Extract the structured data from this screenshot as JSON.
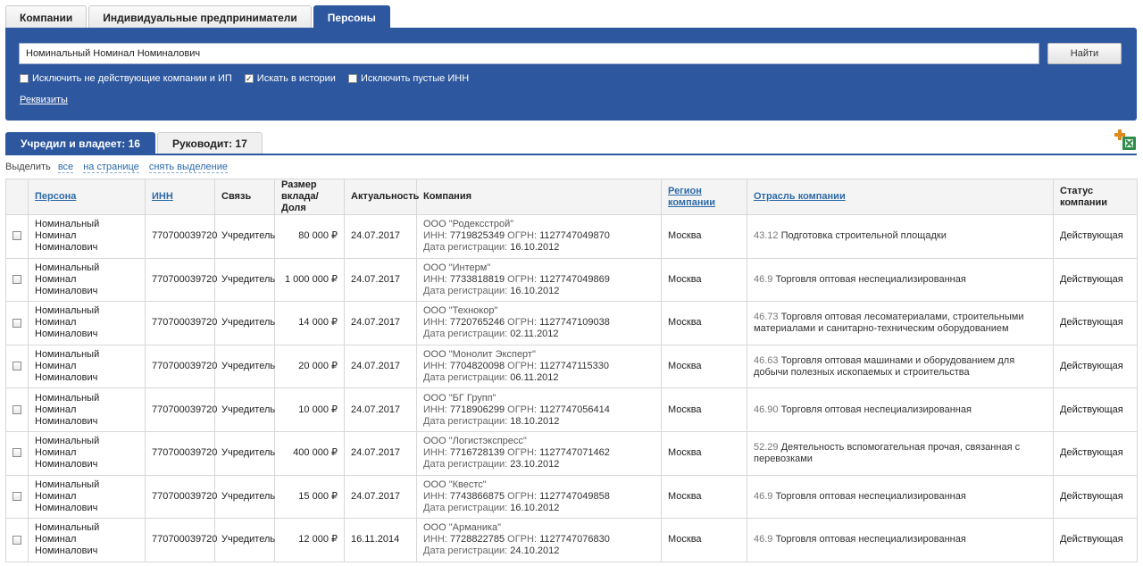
{
  "top_tabs": [
    "Компании",
    "Индивидуальные предприниматели",
    "Персоны"
  ],
  "top_tab_active": 2,
  "search": {
    "value": "Номинальный Номинал Номиналович",
    "button": "Найти",
    "options": [
      {
        "label": "Исключить не действующие компании и ИП",
        "checked": false
      },
      {
        "label": "Искать в истории",
        "checked": true
      },
      {
        "label": "Исключить пустые ИНН",
        "checked": false
      }
    ],
    "requisites_link": "Реквизиты"
  },
  "result_tabs": [
    "Учредил и владеет: 16",
    "Руководит: 17"
  ],
  "result_tab_active": 0,
  "excel_icon": "excel-export-icon",
  "select": {
    "label": "Выделить",
    "all": "все",
    "page": "на странице",
    "clear": "снять выделение"
  },
  "table": {
    "headers": {
      "person": "Персона",
      "inn": "ИНН",
      "link": "Связь",
      "share": "Размер вклада/Доля",
      "actuality": "Актуальность",
      "company": "Компания",
      "region": "Регион компании",
      "industry": "Отрасль компании",
      "status": "Статус компании"
    },
    "labels": {
      "inn": "ИНН:",
      "ogrn": "ОГРН:",
      "reg": "Дата регистрации:"
    },
    "rows": [
      {
        "person": "Номинальный Номинал Номиналович",
        "inn": "770700039720",
        "link": "Учредитель",
        "share": "80 000 ₽",
        "date": "24.07.2017",
        "company": "ООО \"Родексстрой\"",
        "company_inn": "7719825349",
        "company_ogrn": "1127747049870",
        "reg_date": "16.10.2012",
        "region": "Москва",
        "okved_code": "43.12",
        "okved_text": "Подготовка строительной площадки",
        "status": "Действующая"
      },
      {
        "person": "Номинальный Номинал Номиналович",
        "inn": "770700039720",
        "link": "Учредитель",
        "share": "1 000 000 ₽",
        "date": "24.07.2017",
        "company": "ООО \"Интерм\"",
        "company_inn": "7733818819",
        "company_ogrn": "1127747049869",
        "reg_date": "16.10.2012",
        "region": "Москва",
        "okved_code": "46.9",
        "okved_text": "Торговля оптовая неспециализированная",
        "status": "Действующая"
      },
      {
        "person": "Номинальный Номинал Номиналович",
        "inn": "770700039720",
        "link": "Учредитель",
        "share": "14 000 ₽",
        "date": "24.07.2017",
        "company": "ООО \"Технокор\"",
        "company_inn": "7720765246",
        "company_ogrn": "1127747109038",
        "reg_date": "02.11.2012",
        "region": "Москва",
        "okved_code": "46.73",
        "okved_text": "Торговля оптовая лесоматериалами, строительными материалами и санитарно-техническим оборудованием",
        "status": "Действующая"
      },
      {
        "person": "Номинальный Номинал Номиналович",
        "inn": "770700039720",
        "link": "Учредитель",
        "share": "20 000 ₽",
        "date": "24.07.2017",
        "company": "ООО \"Монолит Эксперт\"",
        "company_inn": "7704820098",
        "company_ogrn": "1127747115330",
        "reg_date": "06.11.2012",
        "region": "Москва",
        "okved_code": "46.63",
        "okved_text": "Торговля оптовая машинами и оборудованием для добычи полезных ископаемых и строительства",
        "status": "Действующая"
      },
      {
        "person": "Номинальный Номинал Номиналович",
        "inn": "770700039720",
        "link": "Учредитель",
        "share": "10 000 ₽",
        "date": "24.07.2017",
        "company": "ООО \"БГ Групп\"",
        "company_inn": "7718906299",
        "company_ogrn": "1127747056414",
        "reg_date": "18.10.2012",
        "region": "Москва",
        "okved_code": "46.90",
        "okved_text": "Торговля оптовая неспециализированная",
        "status": "Действующая"
      },
      {
        "person": "Номинальный Номинал Номиналович",
        "inn": "770700039720",
        "link": "Учредитель",
        "share": "400 000 ₽",
        "date": "24.07.2017",
        "company": "ООО \"Логистэкспресс\"",
        "company_inn": "7716728139",
        "company_ogrn": "1127747071462",
        "reg_date": "23.10.2012",
        "region": "Москва",
        "okved_code": "52.29",
        "okved_text": "Деятельность вспомогательная прочая, связанная с перевозками",
        "status": "Действующая"
      },
      {
        "person": "Номинальный Номинал Номиналович",
        "inn": "770700039720",
        "link": "Учредитель",
        "share": "15 000 ₽",
        "date": "24.07.2017",
        "company": "ООО \"Квестс\"",
        "company_inn": "7743866875",
        "company_ogrn": "1127747049858",
        "reg_date": "16.10.2012",
        "region": "Москва",
        "okved_code": "46.9",
        "okved_text": "Торговля оптовая неспециализированная",
        "status": "Действующая"
      },
      {
        "person": "Номинальный Номинал Номиналович",
        "inn": "770700039720",
        "link": "Учредитель",
        "share": "12 000 ₽",
        "date": "16.11.2014",
        "company": "ООО \"Арманика\"",
        "company_inn": "7728822785",
        "company_ogrn": "1127747076830",
        "reg_date": "24.10.2012",
        "region": "Москва",
        "okved_code": "46.9",
        "okved_text": "Торговля оптовая неспециализированная",
        "status": "Действующая"
      }
    ]
  }
}
